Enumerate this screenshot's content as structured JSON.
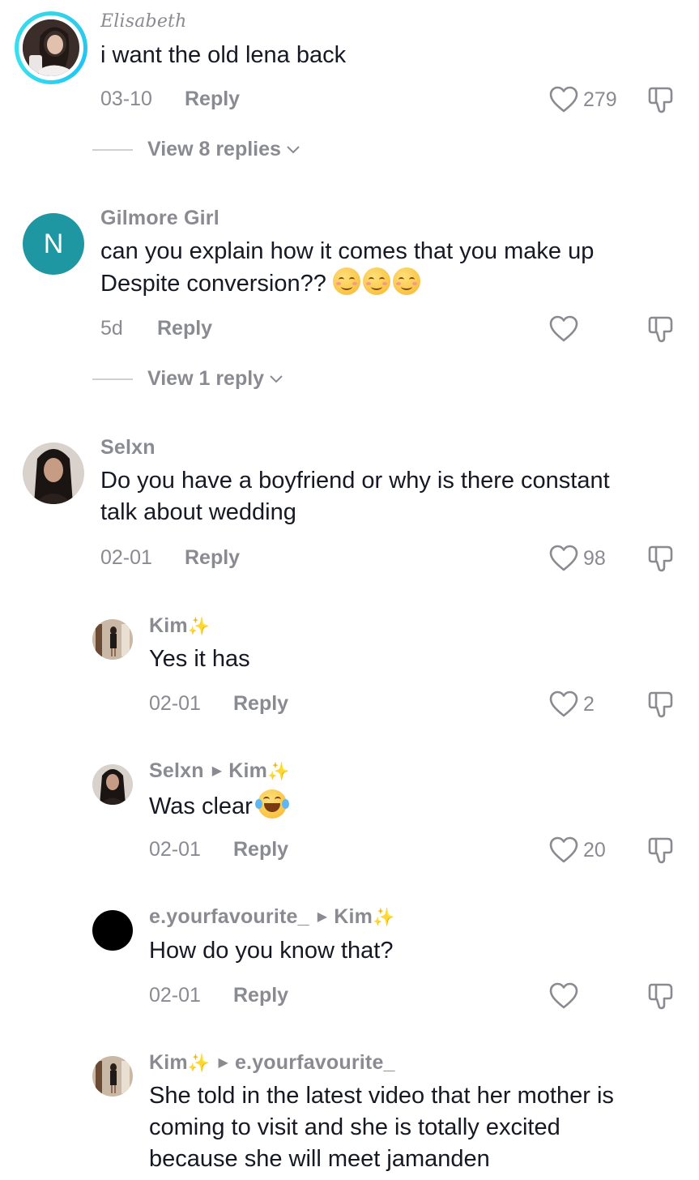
{
  "colors": {
    "text_primary": "#161823",
    "text_secondary": "#8a8b91",
    "story_ring": "#35d4e8",
    "avatar_n_bg": "#1f97a3"
  },
  "comments": [
    {
      "username": "Elisabeth",
      "text": "i want the old lena back",
      "date": "03-10",
      "reply_label": "Reply",
      "likes": "279",
      "view_replies": "View 8 replies"
    },
    {
      "username": "Gilmore Girl",
      "avatar_letter": "N",
      "text": "can you explain how it comes that you make up\nDespite conversion??",
      "date": "5d",
      "reply_label": "Reply",
      "likes": "",
      "view_replies": "View 1 reply"
    },
    {
      "username": "Selxn",
      "text": "Do you have a boyfriend or why is there constant\ntalk about wedding",
      "date": "02-01",
      "reply_label": "Reply",
      "likes": "98"
    }
  ],
  "replies": [
    {
      "username": "Kim",
      "reply_to": "",
      "text": "Yes it has",
      "date": "02-01",
      "reply_label": "Reply",
      "likes": "2"
    },
    {
      "username": "Selxn",
      "reply_to": "Kim",
      "text": "Was clear",
      "date": "02-01",
      "reply_label": "Reply",
      "likes": "20"
    },
    {
      "username": "e.yourfavourite_",
      "reply_to": "Kim",
      "text": "How do you know that?",
      "date": "02-01",
      "reply_label": "Reply",
      "likes": ""
    },
    {
      "username": "Kim",
      "reply_to": "e.yourfavourite_",
      "text": "She told in the latest video that her mother is\ncoming to visit and she is totally excited\nbecause she will meet jamanden"
    }
  ]
}
